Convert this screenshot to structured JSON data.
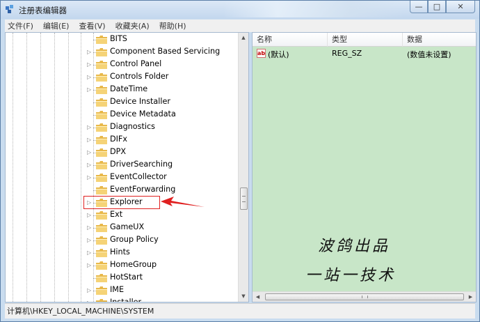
{
  "window": {
    "title": "注册表编辑器",
    "minimize": "—",
    "maximize": "□",
    "close": "✕"
  },
  "menu": [
    "文件(F)",
    "编辑(E)",
    "查看(V)",
    "收藏夹(A)",
    "帮助(H)"
  ],
  "tree": {
    "nodes": [
      {
        "label": "BITS",
        "expandable": false
      },
      {
        "label": "Component Based Servicing",
        "expandable": true
      },
      {
        "label": "Control Panel",
        "expandable": true
      },
      {
        "label": "Controls Folder",
        "expandable": true
      },
      {
        "label": "DateTime",
        "expandable": true
      },
      {
        "label": "Device Installer",
        "expandable": false
      },
      {
        "label": "Device Metadata",
        "expandable": false
      },
      {
        "label": "Diagnostics",
        "expandable": true
      },
      {
        "label": "DIFx",
        "expandable": true
      },
      {
        "label": "DPX",
        "expandable": true
      },
      {
        "label": "DriverSearching",
        "expandable": true
      },
      {
        "label": "EventCollector",
        "expandable": true
      },
      {
        "label": "EventForwarding",
        "expandable": false
      },
      {
        "label": "Explorer",
        "expandable": true
      },
      {
        "label": "Ext",
        "expandable": true
      },
      {
        "label": "GameUX",
        "expandable": true
      },
      {
        "label": "Group Policy",
        "expandable": true
      },
      {
        "label": "Hints",
        "expandable": true
      },
      {
        "label": "HomeGroup",
        "expandable": true
      },
      {
        "label": "HotStart",
        "expandable": false
      },
      {
        "label": "IME",
        "expandable": true
      },
      {
        "label": "Installer",
        "expandable": true
      }
    ],
    "highlighted": "Explorer"
  },
  "values": {
    "columns": [
      "名称",
      "类型",
      "数据"
    ],
    "rows": [
      {
        "name": "(默认)",
        "type": "REG_SZ",
        "data": "(数值未设置)"
      }
    ]
  },
  "watermark": {
    "line1": "波鸽出品",
    "line2": "一站一技术"
  },
  "status": {
    "path": "计算机\\HKEY_LOCAL_MACHINE\\SYSTEM"
  },
  "colors": {
    "right_pane_bg": "#c8e6c8",
    "highlight": "#e02020",
    "folder": "#e8b84a"
  }
}
